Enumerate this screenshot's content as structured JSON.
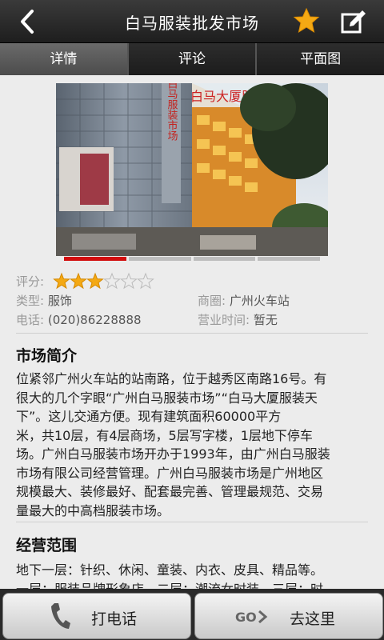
{
  "header": {
    "title": "白马服装批发市场",
    "back_icon": "chevron-left-icon",
    "favorite_icon": "star-icon",
    "edit_icon": "edit-icon",
    "accent_color": "#f4a914"
  },
  "tabs": [
    {
      "label": "详情",
      "active": true
    },
    {
      "label": "评论",
      "active": false
    },
    {
      "label": "平面图",
      "active": false
    }
  ],
  "photo": {
    "sign_vertical": "广州白马服装市场",
    "sign_top": "白马大厦服装天下",
    "indicator_count": 4,
    "active_indicator": 0
  },
  "info": {
    "rating_label": "评分:",
    "rating": 3,
    "rating_max": 6,
    "type_label": "类型:",
    "type_value": "服饰",
    "district_label": "商圈:",
    "district_value": "广州火车站",
    "phone_label": "电话:",
    "phone_value": "(020)86228888",
    "hours_label": "营业时间:",
    "hours_value": "暂无"
  },
  "intro": {
    "title": "市场简介",
    "lines": [
      "位紧邻广州火车站的站南路，位于越秀区南路16号。有",
      "很大的几个字眼“广州白马服装市场”“白马大厦服装天",
      "下”。这儿交通方便。现有建筑面积60000平方",
      "米，共10层，有4层商场，5层写字楼，1层地下停车",
      "场。广州白马服装市场开办于1993年，由广州白马服装",
      "市场有限公司经营管理。广州白马服装市场是广州地区",
      "规模最大、装修最好、配套最完善、管理最规范、交易",
      "量最大的中高档服装市场。"
    ]
  },
  "scope": {
    "title": "经营范围",
    "lines": [
      "地下一层：针织、休闲、童装、内衣、皮具、精品等。",
      "一层：服装品牌形象店、二层：潮流女时装、三层：时"
    ]
  },
  "bottom": {
    "call_label": "打电话",
    "call_icon": "phone-icon",
    "go_label": "去这里",
    "go_icon": "go-arrow-icon"
  }
}
